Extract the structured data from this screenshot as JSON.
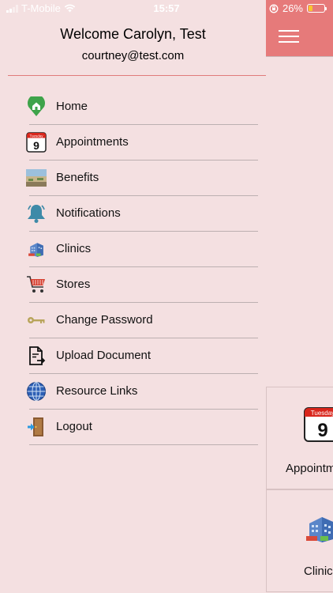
{
  "status_bar": {
    "carrier": "T-Mobile",
    "time": "15:57",
    "battery_percent": "26%",
    "battery_level": 0.26
  },
  "drawer": {
    "title": "Welcome Carolyn, Test",
    "email": "courtney@test.com",
    "items": [
      {
        "label": "Home",
        "icon": "home-pin-icon"
      },
      {
        "label": "Appointments",
        "icon": "calendar-icon"
      },
      {
        "label": "Benefits",
        "icon": "benefits-photo-icon"
      },
      {
        "label": "Notifications",
        "icon": "bell-icon"
      },
      {
        "label": "Clinics",
        "icon": "building-icon"
      },
      {
        "label": "Stores",
        "icon": "shopping-cart-icon"
      },
      {
        "label": "Change Password",
        "icon": "key-icon"
      },
      {
        "label": "Upload Document",
        "icon": "upload-document-icon"
      },
      {
        "label": "Resource Links",
        "icon": "globe-icon"
      },
      {
        "label": "Logout",
        "icon": "logout-door-icon"
      }
    ]
  },
  "calendar_icon": {
    "day_name": "Tuesday",
    "day_number": "9"
  },
  "background_tiles": [
    {
      "label": "Appointm"
    },
    {
      "label": "Clinics"
    }
  ],
  "colors": {
    "background": "#f4e0e1",
    "header": "#e67a7a",
    "divider": "#e07b7b",
    "calendar_red": "#d9261c"
  }
}
